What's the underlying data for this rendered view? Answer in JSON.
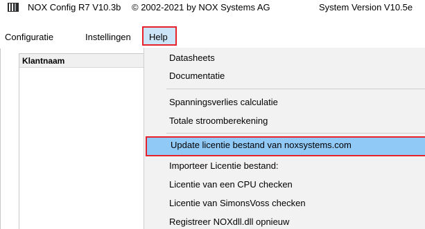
{
  "window": {
    "app_title": "NOX Config R7 V10.3b",
    "copyright": "© 2002-2021 by NOX Systems AG",
    "system_version": "System Version V10.5e"
  },
  "menubar": {
    "items": [
      {
        "label": "Configuratie"
      },
      {
        "label": "Instellingen"
      },
      {
        "label": "Help",
        "state": "open"
      }
    ]
  },
  "list": {
    "column_header": "Klantnaam"
  },
  "help_menu": {
    "items": [
      {
        "label": "Datasheets"
      },
      {
        "label": "Documentatie"
      },
      {
        "label": "Spanningsverlies calculatie"
      },
      {
        "label": "Totale stroomberekening"
      },
      {
        "label": "Update licentie bestand van noxsystems.com",
        "state": "highlighted"
      },
      {
        "label": "Importeer Licentie bestand:"
      },
      {
        "label": "Licentie van een CPU checken"
      },
      {
        "label": "Licentie van SimonsVoss checken"
      },
      {
        "label": "Registreer NOXdll.dll opnieuw"
      }
    ]
  },
  "colors": {
    "highlight_outline": "#e8202a",
    "menu_selected_bg": "#cce4f7",
    "item_highlight_bg": "#90c8f6",
    "dropdown_bg": "#f2f2f2"
  },
  "icons": {
    "app_icon": "nox-app-icon"
  }
}
